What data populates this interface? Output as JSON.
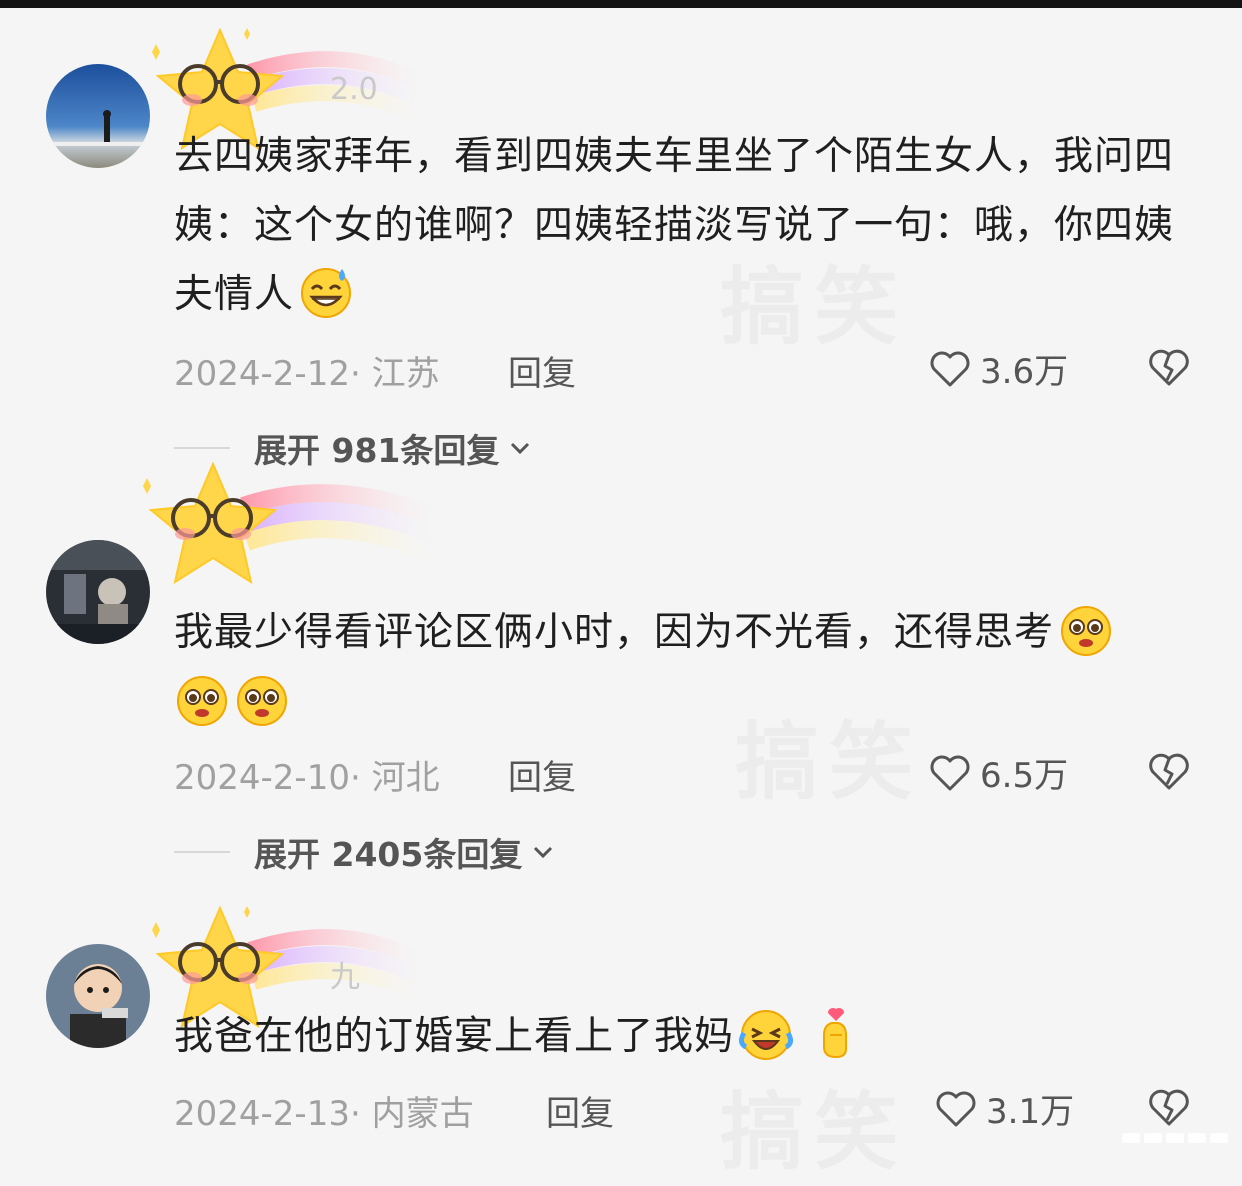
{
  "comments": [
    {
      "username": "2.0",
      "text": "去四姨家拜年，看到四姨夫车里坐了个陌生女人，我问四姨：这个女的谁啊？四姨轻描淡写说了一句：哦，你四姨夫情人",
      "date": "2024-2-12",
      "location": "江苏",
      "reply_label": "回复",
      "likes": "3.6万",
      "expand_label": "展开 981条回复",
      "emojis": [
        "sweat-grin-emoji"
      ]
    },
    {
      "username": "",
      "text": "我最少得看评论区俩小时，因为不光看，还得思考",
      "date": "2024-2-10",
      "location": "河北",
      "reply_label": "回复",
      "likes": "6.5万",
      "expand_label": "展开 2405条回复",
      "emojis": [
        "pleading-emoji",
        "pleading-emoji",
        "pleading-emoji"
      ]
    },
    {
      "username": "九",
      "text": "我爸在他的订婚宴上看上了我妈",
      "date": "2024-2-13",
      "location": "内蒙古",
      "reply_label": "回复",
      "likes": "3.1万",
      "emojis": [
        "laugh-cry-emoji",
        "finger-heart-emoji"
      ]
    }
  ],
  "watermark": "搞笑",
  "colors": {
    "background": "#f5f5f5",
    "text": "#1f1f1f",
    "meta": "#a0a0a0"
  }
}
